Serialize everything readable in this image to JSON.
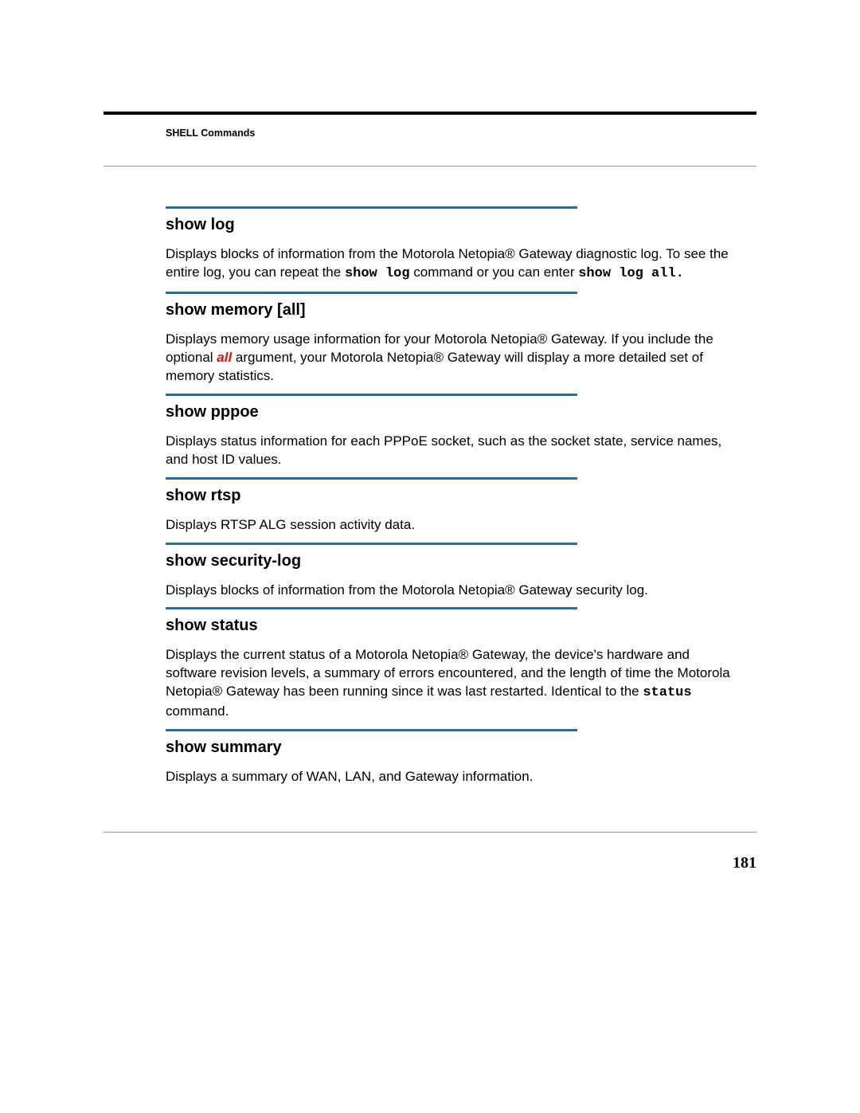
{
  "header": {
    "section": "SHELL Commands"
  },
  "page_number": "181",
  "entries": [
    {
      "heading": "show log",
      "desc_pre": "Displays blocks of information from the Motorola Netopia® Gateway diagnostic log. To see the entire log, you can repeat the ",
      "mono1": "show log",
      "desc_mid": " command or you can enter ",
      "mono2": "show log all.",
      "desc_post": ""
    },
    {
      "heading": "show memory [all]",
      "desc_pre": "Displays memory usage information for your Motorola Netopia® Gateway. If you include the optional ",
      "arg": "all",
      "desc_post": " argument, your Motorola Netopia® Gateway will display a more detailed set of memory statistics."
    },
    {
      "heading": "show pppoe",
      "desc": "Displays status information for each PPPoE socket, such as the socket state, service names, and host ID values."
    },
    {
      "heading": "show rtsp",
      "desc": "Displays RTSP ALG session activity data."
    },
    {
      "heading": "show security-log",
      "desc": "Displays blocks of information from the Motorola Netopia® Gateway security log."
    },
    {
      "heading": "show status",
      "desc_pre": "Displays the current status of a Motorola Netopia® Gateway, the device's hardware and software revision levels, a summary of errors encountered, and the length of time the Motorola Netopia® Gateway has been running since it was last restarted. Identical to the ",
      "mono1": "status",
      "desc_post": " command."
    },
    {
      "heading": "show summary",
      "desc": "Displays a summary of WAN, LAN, and Gateway information."
    }
  ]
}
